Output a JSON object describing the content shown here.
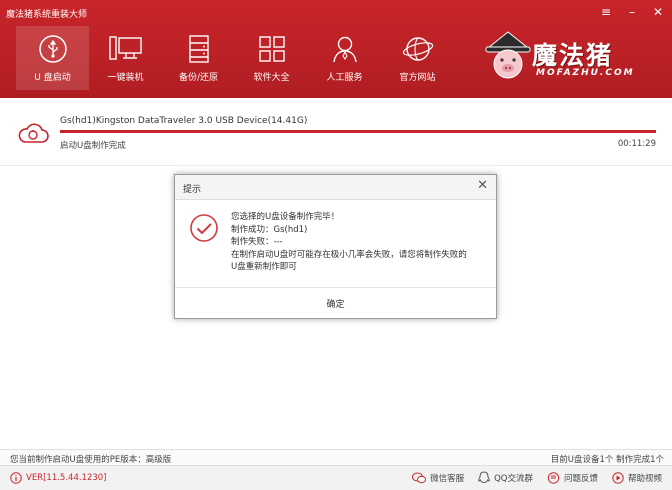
{
  "app": {
    "title": "魔法猪系统重装大师",
    "window_controls": {
      "menu": "≡",
      "minimize": "–",
      "close": "✕"
    }
  },
  "nav": {
    "items": [
      {
        "label": "U 盘启动",
        "icon": "usb-icon",
        "active": true
      },
      {
        "label": "一键装机",
        "icon": "install-icon"
      },
      {
        "label": "备份/还原",
        "icon": "backup-icon"
      },
      {
        "label": "软件大全",
        "icon": "apps-icon"
      },
      {
        "label": "人工服务",
        "icon": "support-icon"
      },
      {
        "label": "官方网站",
        "icon": "globe-icon"
      }
    ]
  },
  "logo": {
    "text": "魔法猪",
    "sub": "MOFAZHU.COM"
  },
  "device": {
    "name": "Gs(hd1)Kingston DataTraveler 3.0 USB Device(14.41G)",
    "status": "启动U盘制作完成",
    "elapsed": "00:11:29",
    "progress_percent": 100
  },
  "dialog": {
    "title": "提示",
    "close": "✕",
    "lines": [
      "您选择的U盘设备制作完毕！",
      "制作成功：Gs(hd1)",
      "制作失败：---",
      "在制作启动U盘时可能存在极小几率会失败，请您将制作失败的",
      "U盘重新制作即可"
    ],
    "ok_label": "确定"
  },
  "info": {
    "left": "您当前制作启动U盘使用的PE版本：高级版",
    "right": "目前U盘设备1个  制作完成1个"
  },
  "footer": {
    "version": "VER[11.5.44.1230]",
    "links": [
      {
        "label": "微信客服",
        "icon": "wechat-icon"
      },
      {
        "label": "QQ交流群",
        "icon": "qq-icon"
      },
      {
        "label": "问题反馈",
        "icon": "feedback-icon"
      },
      {
        "label": "帮助视频",
        "icon": "help-video-icon"
      }
    ]
  },
  "colors": {
    "brand": "#c8252a",
    "accent": "#d03c3c"
  }
}
